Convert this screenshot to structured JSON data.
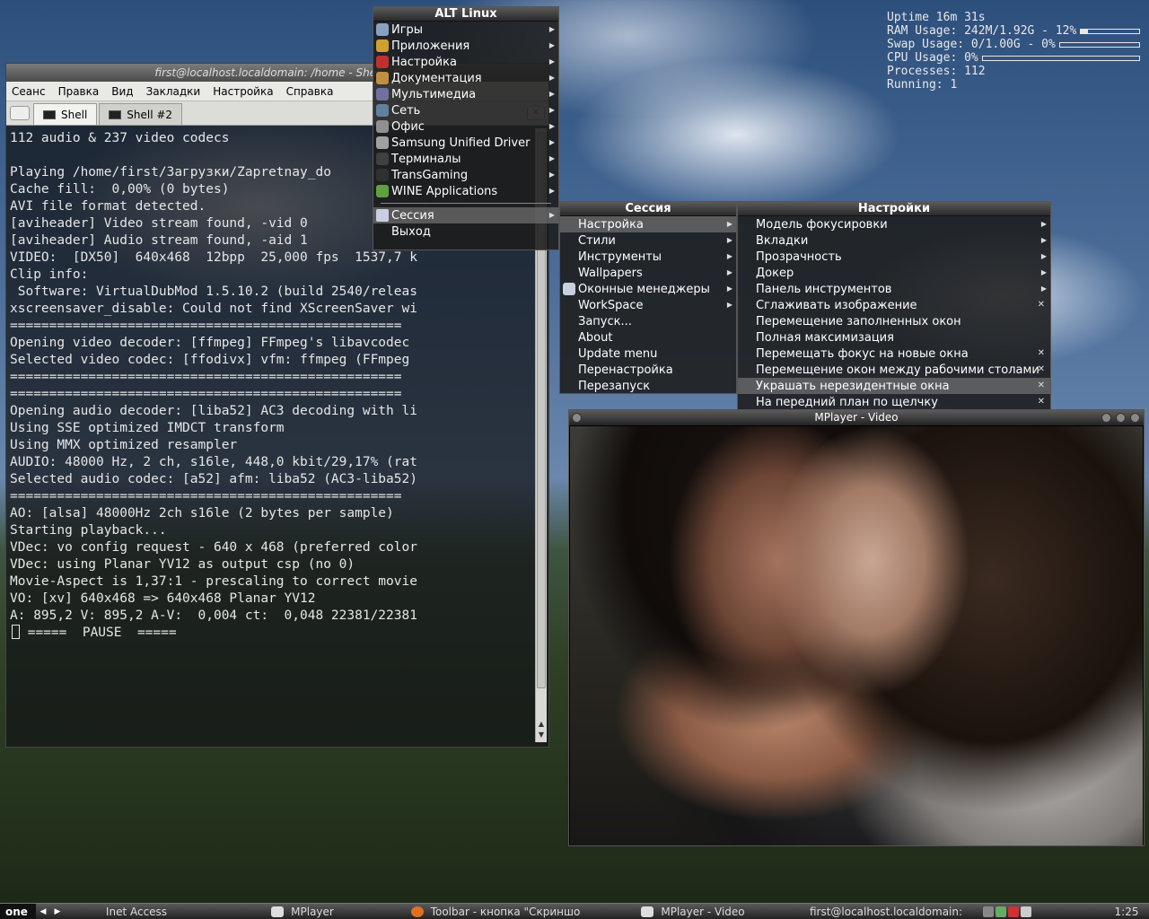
{
  "conky": {
    "uptime": "Uptime 16m 31s",
    "ram": "RAM Usage: 242M/1.92G - 12%",
    "ram_fraction": 0.12,
    "swap": "Swap Usage: 0/1.00G - 0%",
    "swap_fraction": 0.0,
    "cpu": "CPU Usage: 0%",
    "cpu_fraction": 0.0,
    "processes": "Processes: 112",
    "running": "Running: 1"
  },
  "terminal": {
    "title": "first@localhost.localdomain: /home - Shell - K",
    "menu": [
      "Сеанс",
      "Правка",
      "Вид",
      "Закладки",
      "Настройка",
      "Справка"
    ],
    "tabs": [
      "Shell",
      "Shell #2"
    ],
    "lines": [
      "112 audio & 237 video codecs",
      "",
      "Playing /home/first/Загрузки/Zapretnay_do",
      "Cache fill:  0,00% (0 bytes)",
      "AVI file format detected.",
      "[aviheader] Video stream found, -vid 0",
      "[aviheader] Audio stream found, -aid 1",
      "VIDEO:  [DX50]  640x468  12bpp  25,000 fps  1537,7 k",
      "Clip info:",
      " Software: VirtualDubMod 1.5.10.2 (build 2540/releas",
      "xscreensaver_disable: Could not find XScreenSaver wi",
      "==================================================",
      "Opening video decoder: [ffmpeg] FFmpeg's libavcodec",
      "Selected video codec: [ffodivx] vfm: ffmpeg (FFmpeg",
      "==================================================",
      "==================================================",
      "Opening audio decoder: [liba52] AC3 decoding with li",
      "Using SSE optimized IMDCT transform",
      "Using MMX optimized resampler",
      "AUDIO: 48000 Hz, 2 ch, s16le, 448,0 kbit/29,17% (rat",
      "Selected audio codec: [a52] afm: liba52 (AC3-liba52)",
      "==================================================",
      "AO: [alsa] 48000Hz 2ch s16le (2 bytes per sample)",
      "Starting playback...",
      "VDec: vo config request - 640 x 468 (preferred color",
      "VDec: using Planar YV12 as output csp (no 0)",
      "Movie-Aspect is 1,37:1 - prescaling to correct movie",
      "VO: [xv] 640x468 => 640x468 Planar YV12",
      "A: 895,2 V: 895,2 A-V:  0,004 ct:  0,048 22381/22381"
    ],
    "last_line": " =====  PAUSE  ====="
  },
  "alt_menu": {
    "title": "ALT Linux",
    "items": [
      {
        "label": "Игры",
        "icon": "games-icon",
        "color": "#8aa0c0"
      },
      {
        "label": "Приложения",
        "icon": "applications-icon",
        "color": "#d0a030"
      },
      {
        "label": "Настройка",
        "icon": "settings-icon",
        "color": "#c03030"
      },
      {
        "label": "Документация",
        "icon": "documentation-icon",
        "color": "#c09040"
      },
      {
        "label": "Мультимедиа",
        "icon": "multimedia-icon",
        "color": "#7070a0"
      },
      {
        "label": "Сеть",
        "icon": "network-icon",
        "color": "#6080a0"
      },
      {
        "label": "Офис",
        "icon": "office-icon",
        "color": "#909090"
      },
      {
        "label": "Samsung Unified Driver",
        "icon": "printer-icon",
        "color": "#a0a0a0"
      },
      {
        "label": "Терминалы",
        "icon": "terminal-icon",
        "color": "#404040"
      },
      {
        "label": "TransGaming",
        "icon": "transgaming-icon",
        "color": "#303030"
      },
      {
        "label": "WINE Applications",
        "icon": "wine-icon",
        "color": "#60a040"
      }
    ],
    "session": "Сессия",
    "exit": "Выход"
  },
  "session_menu": {
    "title": "Сессия",
    "items": [
      "Настройка",
      "Стили",
      "Инструменты",
      "Wallpapers",
      "Оконные менеджеры",
      "WorkSpace",
      "Запуск...",
      "About",
      "Update menu",
      "Перенастройка",
      "Перезапуск"
    ]
  },
  "settings_menu": {
    "title": "Настройки",
    "items": [
      "Модель фокусировки",
      "Вкладки",
      "Прозрачность",
      "Докер",
      "Панель инструментов",
      "Сглаживать изображение",
      "Перемещение заполненных окон",
      "Полная максимизация",
      "Перемещать фокус на новые окна",
      "Перемещение окон между рабочими столами",
      "Украшать нерезидентные окна",
      "На передний план по щелчку"
    ]
  },
  "mplayer": {
    "title": "MPlayer - Video"
  },
  "taskbar": {
    "workspace": "one",
    "tasks": [
      "Inet Access",
      "MPlayer",
      "Toolbar - кнопка \"Скриншо",
      "MPlayer - Video",
      "first@localhost.localdomain:"
    ],
    "clock": "1:25"
  }
}
